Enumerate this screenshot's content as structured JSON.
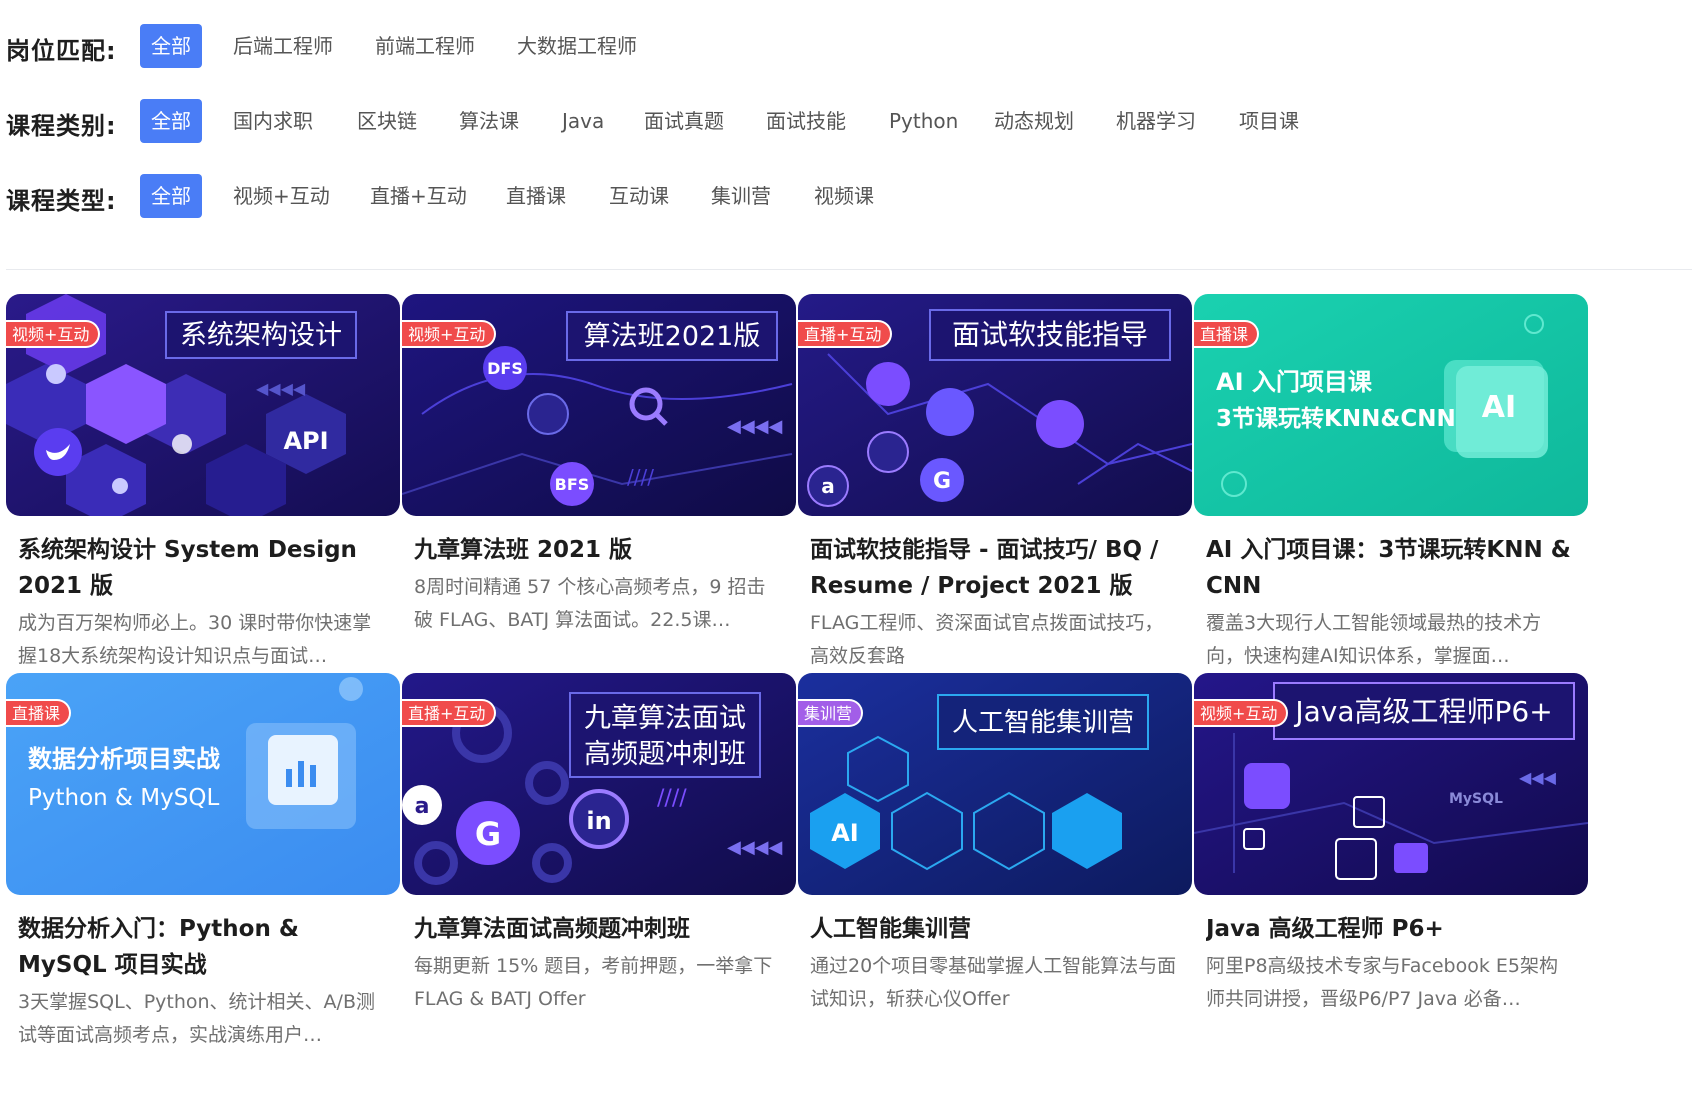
{
  "filters": [
    {
      "label": "岗位匹配:",
      "options": [
        "全部",
        "后端工程师",
        "前端工程师",
        "大数据工程师"
      ],
      "active": 0
    },
    {
      "label": "课程类别:",
      "options": [
        "全部",
        "国内求职",
        "区块链",
        "算法课",
        "Java",
        "面试真题",
        "面试技能",
        "Python",
        "动态规划",
        "机器学习",
        "项目课"
      ],
      "active": 0
    },
    {
      "label": "课程类型:",
      "options": [
        "全部",
        "视频+互动",
        "直播+互动",
        "直播课",
        "互动课",
        "集训营",
        "视频课"
      ],
      "active": 0
    }
  ],
  "courses": [
    {
      "badge": "视频+互动",
      "badge_color": "red",
      "banner": "系统架构设计",
      "title": "系统架构设计 System Design 2021 版",
      "desc": "成为百万架构师必上。30 课时带你快速掌握18大系统架构设计知识点与面试…",
      "theme": "purple"
    },
    {
      "badge": "视频+互动",
      "badge_color": "red",
      "banner": "算法班2021版",
      "title": "九章算法班 2021 版",
      "desc": "8周时间精通 57 个核心高频考点，9 招击破 FLAG、BATJ 算法面试。22.5课…",
      "theme": "purple"
    },
    {
      "badge": "直播+互动",
      "badge_color": "red",
      "banner": "面试软技能指导",
      "title": "面试软技能指导 - 面试技巧/ BQ / Resume / Project 2021 版",
      "desc": "FLAG工程师、资深面试官点拨面试技巧，高效反套路",
      "theme": "purple"
    },
    {
      "badge": "直播课",
      "badge_color": "red",
      "banner_line1": "AI 入门项目课",
      "banner_line2": "3节课玩转KNN&CNN",
      "title": "AI 入门项目课：3节课玩转KNN & CNN",
      "desc": "覆盖3大现行人工智能领域最热的技术方向，快速构建AI知识体系，掌握面…",
      "theme": "teal"
    },
    {
      "badge": "直播课",
      "badge_color": "red",
      "banner_line1": "数据分析项目实战",
      "banner_line2": "Python & MySQL",
      "title": "数据分析入门：Python & MySQL 项目实战",
      "desc": "3天掌握SQL、Python、统计相关、A/B测试等面试高频考点，实战演练用户…",
      "theme": "blue"
    },
    {
      "badge": "直播+互动",
      "badge_color": "red",
      "banner_line1": "九章算法面试",
      "banner_line2": "高频题冲刺班",
      "title": "九章算法面试高频题冲刺班",
      "desc": "每期更新 15% 题目，考前押题，一举拿下FLAG & BATJ Offer",
      "theme": "purple"
    },
    {
      "badge": "集训营",
      "badge_color": "purple",
      "banner": "人工智能集训营",
      "title": "人工智能集训营",
      "desc": "通过20个项目零基础掌握人工智能算法与面试知识，斩获心仪Offer",
      "theme": "navy"
    },
    {
      "badge": "视频+互动",
      "badge_color": "red",
      "banner": "Java高级工程师P6+",
      "title": "Java 高级工程师 P6+",
      "desc": "阿里P8高级技术专家与Facebook E5架构师共同讲授，晋级P6/P7 Java 必备…",
      "theme": "purple"
    }
  ],
  "thumb_text": {
    "api": "API",
    "dfs": "DFS",
    "bfs": "BFS",
    "ai": "AI",
    "mysql": "MySQL",
    "g": "G",
    "a": "a",
    "in": "in"
  }
}
